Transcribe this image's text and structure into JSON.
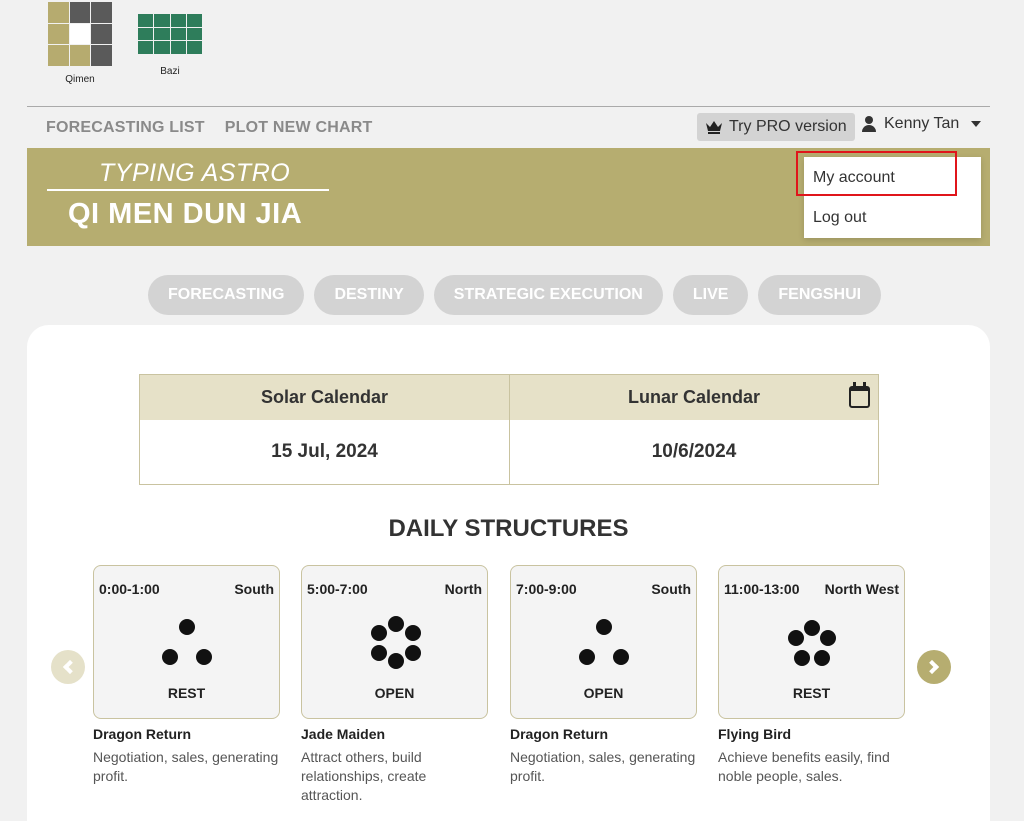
{
  "apps": [
    {
      "label": "Qimen",
      "icon": "qimen-grid-icon"
    },
    {
      "label": "Bazi",
      "icon": "bazi-grid-icon"
    }
  ],
  "topnav": {
    "forecasting_list": "FORECASTING LIST",
    "plot_new_chart": "PLOT NEW CHART",
    "pro_label": "Try PRO version",
    "user_name": "Kenny Tan"
  },
  "banner": {
    "subtitle": "TYPING ASTRO",
    "title": "QI MEN DUN JIA"
  },
  "dropdown": {
    "my_account": "My account",
    "log_out": "Log out"
  },
  "tabs": [
    "FORECASTING",
    "DESTINY",
    "STRATEGIC EXECUTION",
    "LIVE",
    "FENGSHUI"
  ],
  "calendar": {
    "solar_label": "Solar Calendar",
    "solar_value": "15 Jul, 2024",
    "lunar_label": "Lunar Calendar",
    "lunar_value": "10/6/2024"
  },
  "daily_title": "DAILY STRUCTURES",
  "structures": [
    {
      "time": "0:00-1:00",
      "direction": "South",
      "state": "REST",
      "name": "Dragon Return",
      "desc": "Negotiation, sales, generating profit.",
      "dots": 3
    },
    {
      "time": "5:00-7:00",
      "direction": "North",
      "state": "OPEN",
      "name": "Jade Maiden",
      "desc": "Attract others, build relationships, create attraction.",
      "dots": 6
    },
    {
      "time": "7:00-9:00",
      "direction": "South",
      "state": "OPEN",
      "name": "Dragon Return",
      "desc": "Negotiation, sales, generating profit.",
      "dots": 3
    },
    {
      "time": "11:00-13:00",
      "direction": "North West",
      "state": "REST",
      "name": "Flying Bird",
      "desc": "Achieve benefits easily, find noble people, sales.",
      "dots": 5
    }
  ],
  "colors": {
    "accent": "#b6ad70",
    "highlight": "#e0151b"
  }
}
